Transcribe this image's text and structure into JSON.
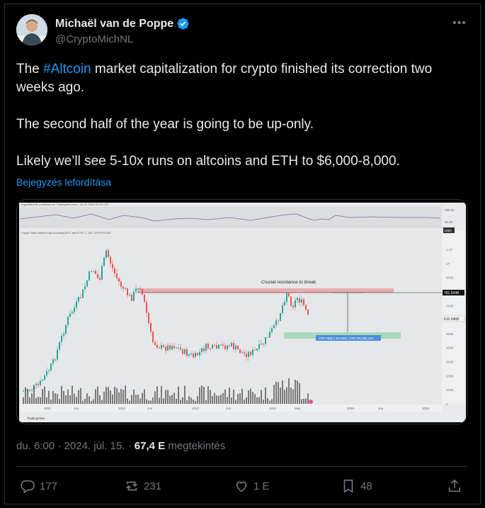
{
  "author": {
    "display_name": "Michaël van de Poppe",
    "handle": "@CryptoMichNL",
    "avatar_icon": "avatar-photo",
    "verified_icon": "verified-badge-icon",
    "verified_color": "#1d9bf0"
  },
  "more_label": "•••",
  "post": {
    "p1_before": "The ",
    "hashtag": "#Altcoin",
    "p1_after": " market capitalization for crypto finished its correction two weeks ago.",
    "p2": "The second half of the year is going to be up-only.",
    "p3": "Likely we’ll see 5-10x runs on altcoins and ETH to $6,000-8,000."
  },
  "translate_label": "Bejegyzés lefordítása",
  "chart": {
    "header_text": "cryptoMichNL published on TradingView.com, Jul 15, 2024 07:10 UTC",
    "indicator_line": "Crypto Total Market Cap Excluding BTC and ETH, 1, 1W, CRYPTOCAP",
    "annotation": "Crucial resistance to break.",
    "price_label": "781.934B",
    "current_label": "610.046B",
    "measure_label": "-279.746B (-35.53%) -279,746,305,110",
    "currency": "USD",
    "brand": "TradingView",
    "osc_ticks": [
      "100.00",
      "50.00"
    ],
    "y_ticks": [
      "1.1T",
      "1T",
      "900B",
      "800B",
      "700B",
      "600B",
      "500B",
      "400B",
      "300B",
      "200B",
      "100B",
      "0"
    ],
    "x_ticks": [
      "2021",
      "Jun",
      "2022",
      "Jun",
      "2023",
      "Jun",
      "2024",
      "May",
      "2025",
      "Jun",
      "2026"
    ],
    "accent_green": "#26a69a",
    "accent_red": "#ef5350",
    "resistance_color": "#e8a0a5",
    "support_color": "#9fd3b0"
  },
  "meta": {
    "time": "du. 6:00 · 2024. júl. 15. · ",
    "views": "67,4 E",
    "views_label": " megtekintés"
  },
  "actions": {
    "replies": "177",
    "reposts": "231",
    "likes": "1 E",
    "bookmarks": "48"
  }
}
